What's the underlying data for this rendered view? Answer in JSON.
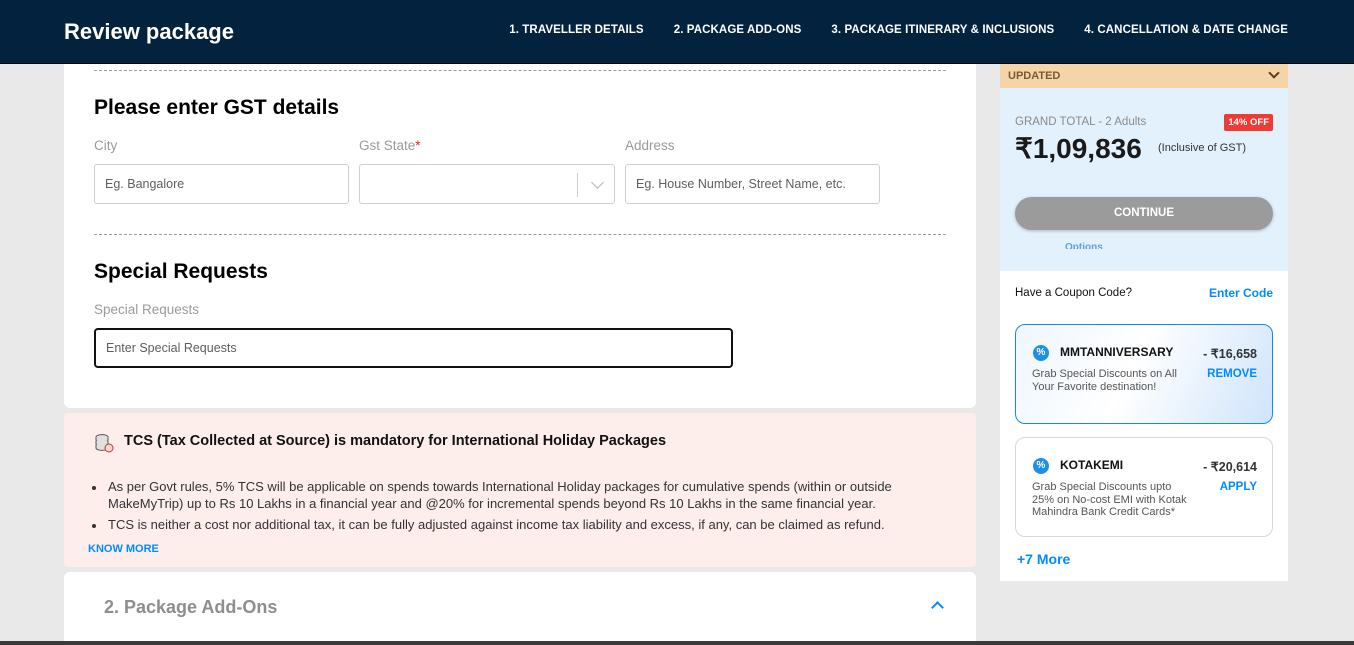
{
  "header": {
    "title": "Review package",
    "steps": [
      "1. TRAVELLER DETAILS",
      "2. PACKAGE ADD-ONS",
      "3. PACKAGE ITINERARY & INCLUSIONS",
      "4. CANCELLATION & DATE CHANGE"
    ]
  },
  "gst": {
    "heading": "Please enter GST details",
    "city_label": "City",
    "city_placeholder": "Eg. Bangalore",
    "state_label": "Gst State",
    "state_required": "*",
    "state_value": "",
    "address_label": "Address",
    "address_placeholder": "Eg. House Number, Street Name, etc."
  },
  "special": {
    "heading": "Special Requests",
    "label": "Special Requests",
    "placeholder": "Enter Special Requests"
  },
  "tcs": {
    "heading": "TCS (Tax Collected at Source) is mandatory for International Holiday Packages",
    "bullets": [
      "As per Govt rules, 5% TCS will be applicable on spends towards International Holiday packages for cumulative spends (within or outside MakeMyTrip) up to Rs 10 Lakhs in a financial year and @20% for incremental spends beyond Rs 10 Lakhs in the same financial year.",
      "TCS is neither a cost nor additional tax, it can be fully adjusted against income tax liability and excess, if any, can be claimed as refund."
    ],
    "know_more": "KNOW MORE"
  },
  "addons": {
    "title": "2. Package Add-Ons"
  },
  "sidebar": {
    "updated": "UPDATED",
    "grand_total_label": "GRAND TOTAL - 2 Adults",
    "badge": "14% OFF",
    "amount": "₹1,09,836",
    "inclusive": "(Inclusive of GST)",
    "continue": "CONTINUE",
    "options": "Options",
    "coupon_question": "Have a Coupon Code?",
    "enter_code": "Enter Code",
    "coupons": [
      {
        "code": "MMTANNIVERSARY",
        "discount": "- ₹16,658",
        "desc": "Grab Special Discounts on All Your Favorite destination!",
        "action": "REMOVE"
      },
      {
        "code": "KOTAKEMI",
        "discount": "- ₹20,614",
        "desc": "Grab Special Discounts upto 25% on No-cost EMI with Kotak Mahindra Bank Credit Cards*",
        "action": "APPLY"
      }
    ],
    "more": "+7 More"
  },
  "colors": {
    "header_bg": "#03223d",
    "accent": "#008cff",
    "tcs_bg": "#fdeeec",
    "badge": "#ec3c35",
    "updated_bg": "#f5d4a8"
  }
}
